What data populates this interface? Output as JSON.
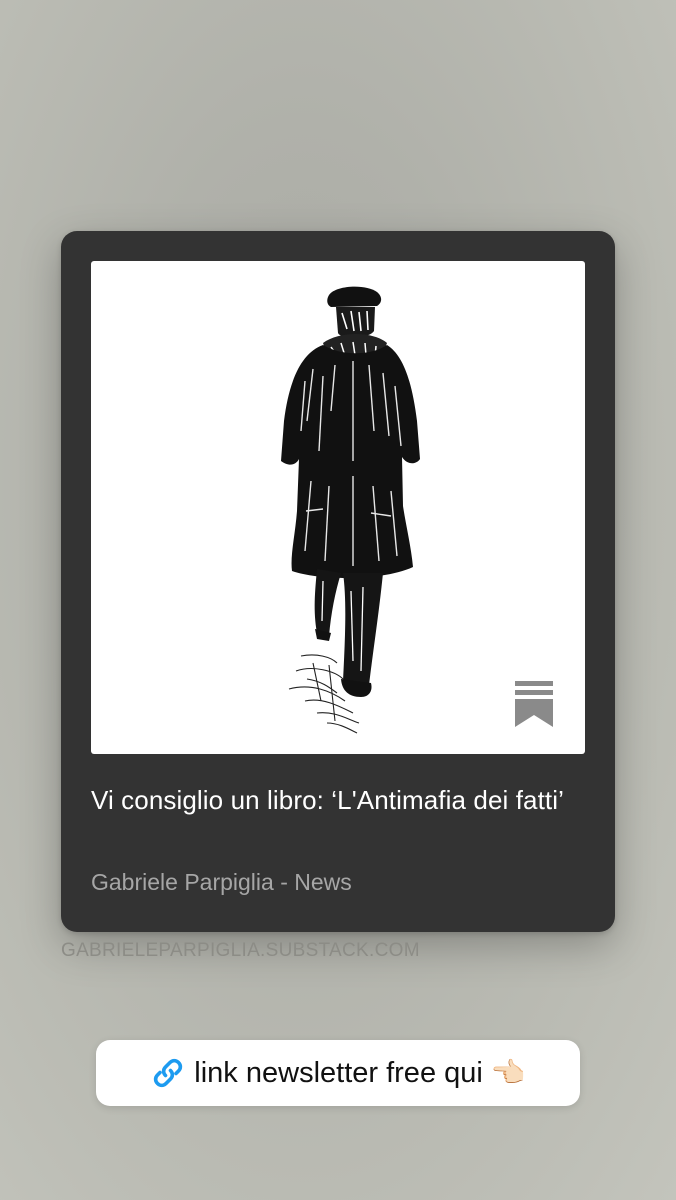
{
  "card": {
    "title": "Vi consiglio un libro: ‘L'Antimafia dei fatti’",
    "author_line": "Gabriele Parpiglia - News",
    "image_icon": "bookmark-icon"
  },
  "source": {
    "domain": "GABRIELEPARPIGLIA.SUBSTACK.COM"
  },
  "link_sticker": {
    "label": "link newsletter free qui",
    "leading_icon": "link-icon",
    "trailing_emoji": "👈🏻"
  },
  "colors": {
    "card_background": "#333333",
    "link_accent": "#1d9bf0"
  }
}
